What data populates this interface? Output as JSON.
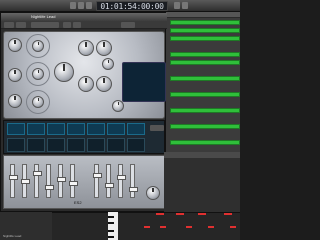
{
  "transport": {
    "position": "01:01:54:00:00"
  },
  "plugin": {
    "title": "Nightlife Lead",
    "name": "ES2"
  },
  "inspector": {
    "label": "Nightlife Lead"
  }
}
